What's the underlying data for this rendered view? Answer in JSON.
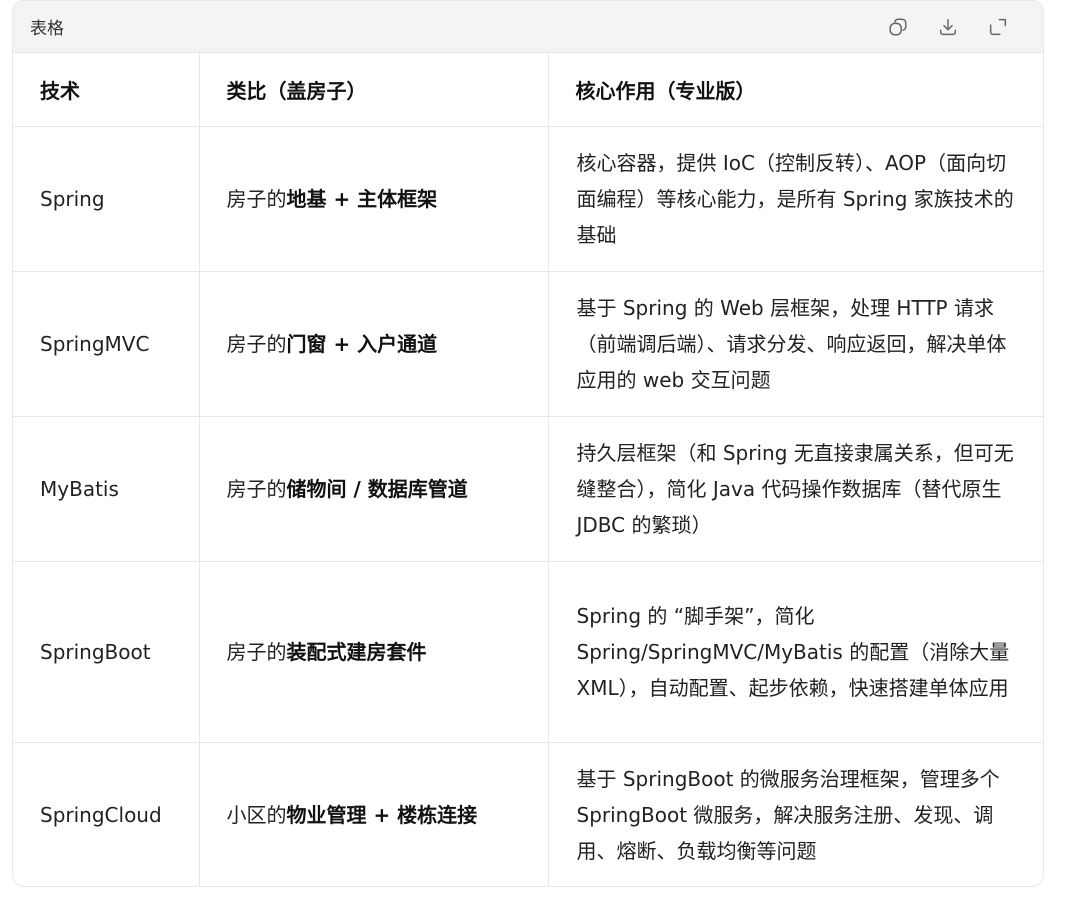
{
  "header": {
    "title": "表格",
    "actions": {
      "copy_icon": "copy-icon",
      "download_icon": "download-icon",
      "expand_icon": "expand-icon"
    }
  },
  "table": {
    "columns": [
      "技术",
      "类比（盖房子）",
      "核心作用（专业版）"
    ],
    "rows": [
      {
        "tech": "Spring",
        "analogy_prefix": "房子的",
        "analogy_bold": "地基 + 主体框架",
        "desc": "核心容器，提供 IoC（控制反转）、AOP（面向切面编程）等核心能力，是所有 Spring 家族技术的基础"
      },
      {
        "tech": "SpringMVC",
        "analogy_prefix": "房子的",
        "analogy_bold": "门窗 + 入户通道",
        "desc": "基于 Spring 的 Web 层框架，处理 HTTP 请求（前端调后端）、请求分发、响应返回，解决单体应用的 web 交互问题"
      },
      {
        "tech": "MyBatis",
        "analogy_prefix": "房子的",
        "analogy_bold": "储物间 / 数据库管道",
        "desc": "持久层框架（和 Spring 无直接隶属关系，但可无缝整合），简化 Java 代码操作数据库（替代原生 JDBC 的繁琐）"
      },
      {
        "tech": "SpringBoot",
        "analogy_prefix": "房子的",
        "analogy_bold": "装配式建房套件",
        "desc": "Spring 的 “脚手架”，简化 Spring/SpringMVC/MyBatis 的配置（消除大量 XML），自动配置、起步依赖，快速搭建单体应用"
      },
      {
        "tech": "SpringCloud",
        "analogy_prefix": "小区的",
        "analogy_bold": "物业管理 + 楼栋连接",
        "desc": "基于 SpringBoot 的微服务治理框架，管理多个 SpringBoot 微服务，解决服务注册、发现、调用、熔断、负载均衡等问题"
      }
    ]
  }
}
